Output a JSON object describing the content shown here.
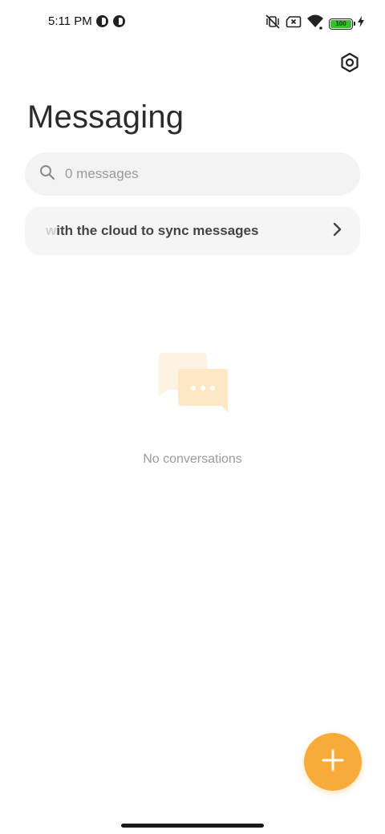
{
  "status_bar": {
    "time": "5:11 PM",
    "battery_level": "100",
    "battery_color": "#36c02b",
    "icons": [
      "notification-circle-icon",
      "notification-circle-icon",
      "vibrate-off-icon",
      "sim-x-icon",
      "wifi-icon",
      "battery-icon",
      "charging-bolt-icon"
    ]
  },
  "header": {
    "title": "Messaging",
    "settings_icon": "gear-icon"
  },
  "search": {
    "placeholder": "0 messages",
    "icon": "search-icon"
  },
  "sync_banner": {
    "text": "with the cloud to sync messages",
    "icon": "chevron-right-icon"
  },
  "empty_state": {
    "illustration": "chat-bubbles-icon",
    "text": "No conversations"
  },
  "fab": {
    "icon": "plus-icon",
    "color": "#f7ab3a"
  }
}
